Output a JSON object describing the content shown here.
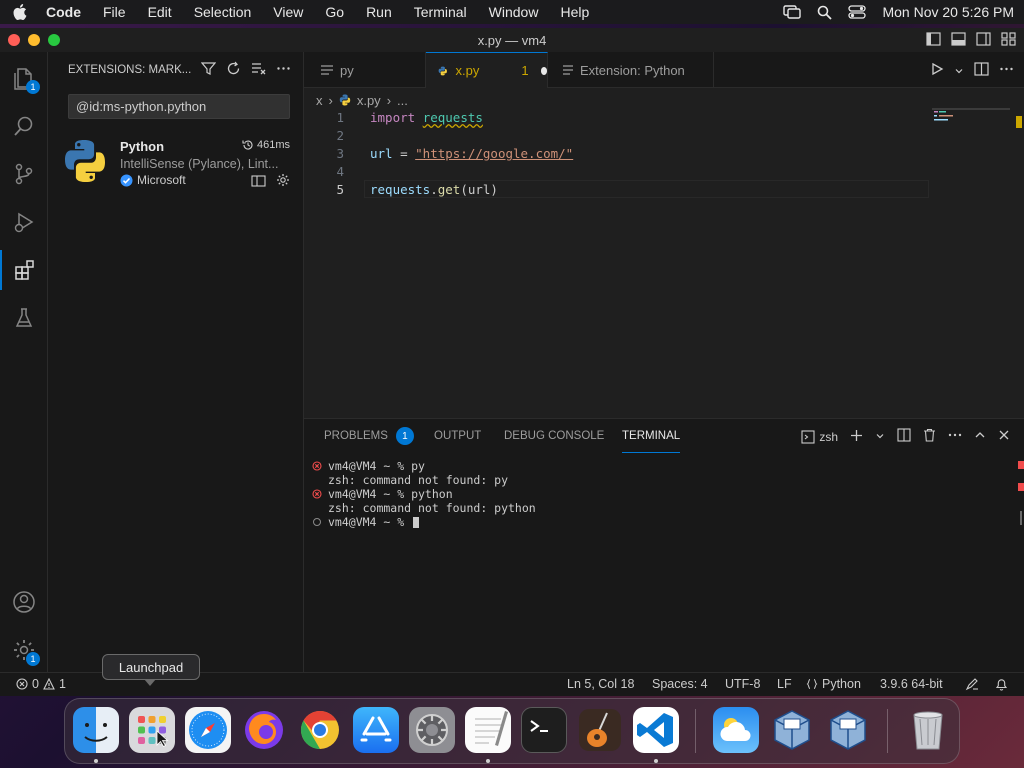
{
  "menubar": {
    "app": "Code",
    "items": [
      "File",
      "Edit",
      "Selection",
      "View",
      "Go",
      "Run",
      "Terminal",
      "Window",
      "Help"
    ],
    "clock": "Mon Nov 20  5:26 PM"
  },
  "window": {
    "title": "x.py — vm4"
  },
  "activity": {
    "explorer_badge": "1",
    "settings_badge": "1"
  },
  "sidebar": {
    "title": "EXTENSIONS: MARK...",
    "search_value": "@id:ms-python.python",
    "extension": {
      "name": "Python",
      "time": "461ms",
      "description": "IntelliSense (Pylance), Lint...",
      "publisher": "Microsoft"
    }
  },
  "tabs": [
    {
      "label": "py"
    },
    {
      "label": "x.py",
      "problems": "1"
    },
    {
      "label": "Extension: Python"
    }
  ],
  "breadcrumb": {
    "folder": "x",
    "file": "x.py",
    "more": "..."
  },
  "editor": {
    "line_numbers": [
      "1",
      "2",
      "3",
      "4",
      "5"
    ],
    "code": {
      "l1_kw": "import",
      "l1_mod": "requests",
      "l3_var": "url",
      "l3_eq": " = ",
      "l3_str": "\"https://google.com/\"",
      "l5_var": "requests",
      "l5_dot": ".",
      "l5_fn": "get",
      "l5_args": "(url)"
    }
  },
  "panel": {
    "tabs": {
      "problems": "PROBLEMS",
      "problems_count": "1",
      "output": "OUTPUT",
      "debug": "DEBUG CONSOLE",
      "terminal": "TERMINAL"
    },
    "shell": "zsh",
    "terminal_lines": [
      "vm4@VM4 ~ % py",
      "zsh: command not found: py",
      "vm4@VM4 ~ % python",
      "zsh: command not found: python",
      "vm4@VM4 ~ % "
    ]
  },
  "statusbar": {
    "errors": "0",
    "warnings": "1",
    "position": "Ln 5, Col 18",
    "spaces": "Spaces: 4",
    "encoding": "UTF-8",
    "eol": "LF",
    "language": "Python",
    "interpreter": "3.9.6 64-bit"
  },
  "tooltip": {
    "label": "Launchpad"
  },
  "dock": {
    "apps": [
      "finder-icon",
      "launchpad-icon",
      "safari-icon",
      "firefox-icon",
      "chrome-icon",
      "app-store-icon",
      "system-settings-icon",
      "textedit-icon",
      "terminal-icon",
      "garageband-icon",
      "vscode-icon",
      "weather-icon",
      "virtualbox-icon",
      "virtualbox-vm-icon",
      "trash-icon"
    ]
  },
  "colors": {
    "accent": "#0078d4",
    "warning": "#cca700",
    "error": "#f14c4c"
  }
}
